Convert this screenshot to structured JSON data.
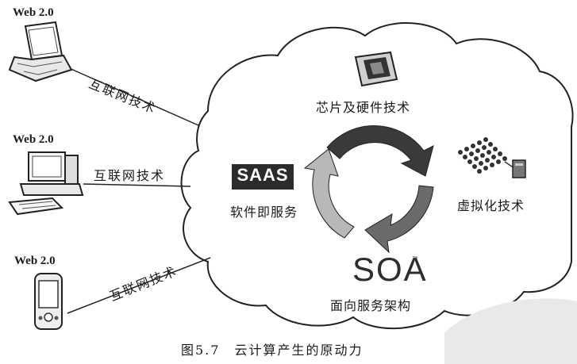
{
  "devices": [
    {
      "label": "Web 2.0",
      "link_label": "互联网技术",
      "icon": "laptop-icon"
    },
    {
      "label": "Web 2.0",
      "link_label": "互联网技术",
      "icon": "desktop-computer-icon"
    },
    {
      "label": "Web 2.0",
      "link_label": "互联网技术",
      "icon": "pda-icon"
    }
  ],
  "cloud": {
    "chip_label": "芯片及硬件技术",
    "virtualization_label": "虚拟化技术",
    "saas_badge": "SAAS",
    "saas_label": "软件即服务",
    "soa_logo": "SOA",
    "soa_tm": "™",
    "soa_label": "面向服务架构"
  },
  "caption": "图5.7　云计算产生的原动力"
}
